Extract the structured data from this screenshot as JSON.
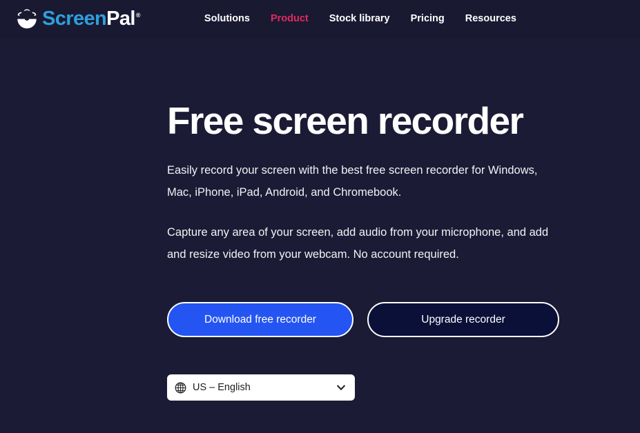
{
  "header": {
    "brand": {
      "icon": "screenpal-logo-icon",
      "name_blue": "Screen",
      "name_white": "Pal",
      "trademark": "®"
    },
    "nav": [
      {
        "label": "Solutions",
        "active": false
      },
      {
        "label": "Product",
        "active": true
      },
      {
        "label": "Stock library",
        "active": false
      },
      {
        "label": "Pricing",
        "active": false
      },
      {
        "label": "Resources",
        "active": false
      }
    ]
  },
  "hero": {
    "title": "Free screen recorder",
    "paragraph_1": "Easily record your screen with the best free screen recorder for Windows, Mac, iPhone, iPad, Android, and Chromebook.",
    "paragraph_2": "Capture any area of your screen, add audio from your microphone, and add and resize video from your webcam. No account required.",
    "primary_button": "Download free recorder",
    "secondary_button": "Upgrade recorder"
  },
  "language_select": {
    "icon": "globe-icon",
    "value": "US – English",
    "chevron": "chevron-down-icon"
  },
  "colors": {
    "page_background": "#1b1b35",
    "header_background": "#191932",
    "accent_pink": "#e22a5f",
    "brand_blue": "#2e9fdc",
    "primary_button": "#2455f2",
    "secondary_button": "#0b1038",
    "text_white": "#ffffff"
  }
}
